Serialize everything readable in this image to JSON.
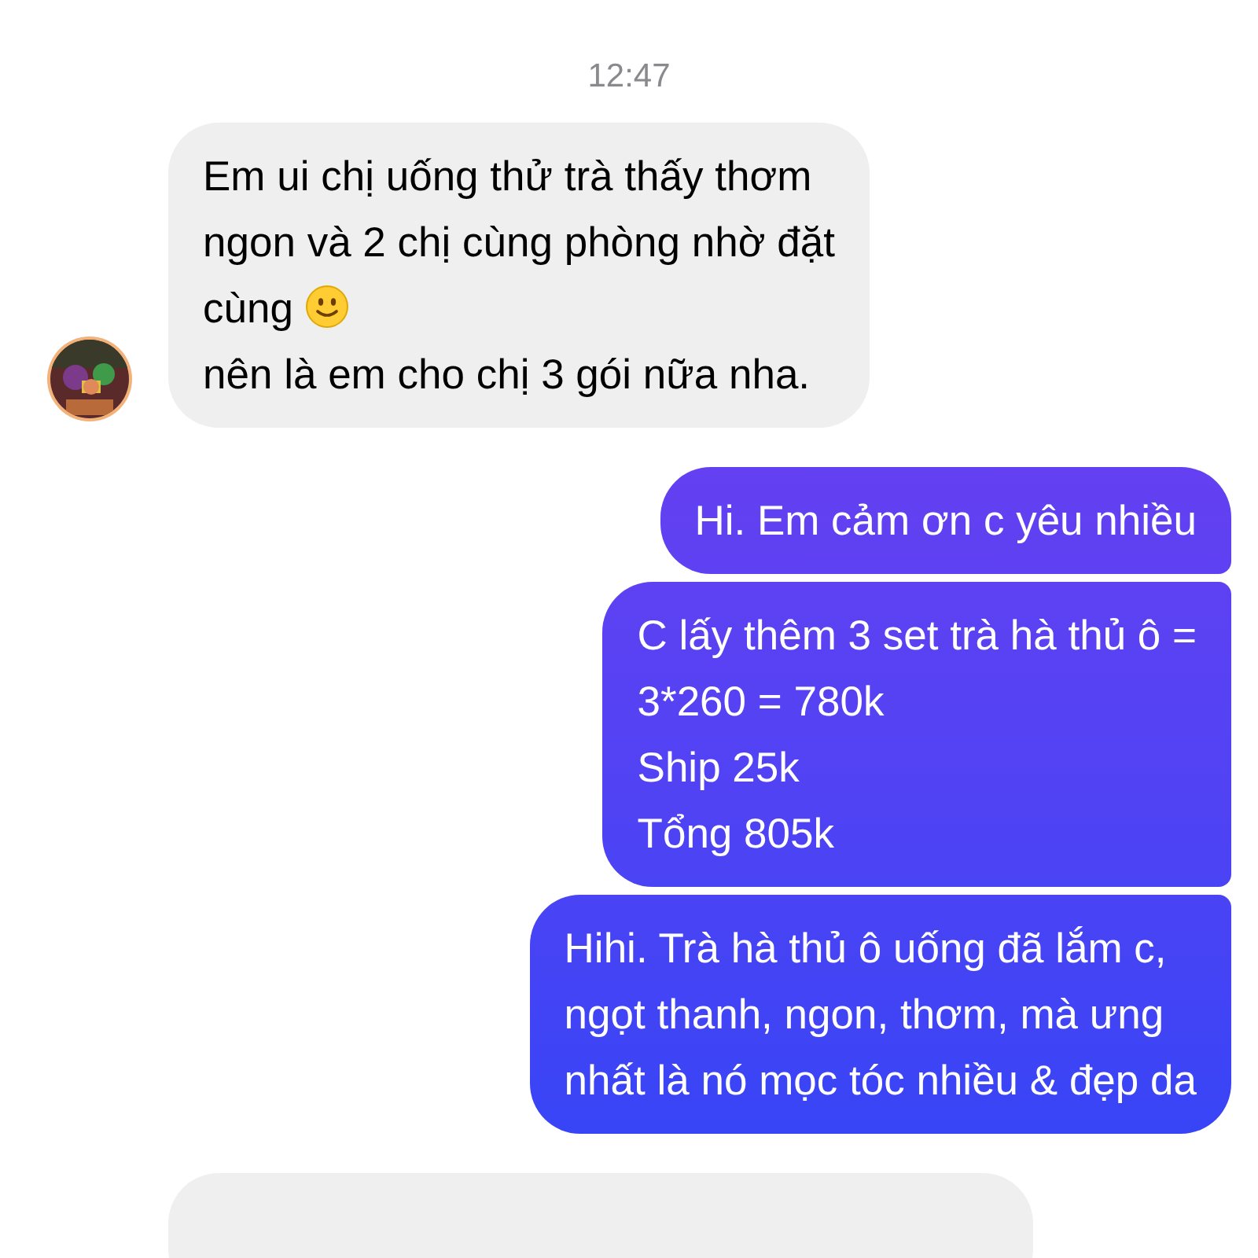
{
  "timestamp": "12:47",
  "messages": [
    {
      "kind": "received",
      "paragraphs": [
        {
          "text": "Em ui chị uống thử trà thấy thơm\nngon và 2 chị cùng phòng nhờ đặt",
          "emoji": false
        },
        {
          "text": "cùng",
          "emoji": true
        },
        {
          "text": "nên là em cho chị 3 gói nữa nha.",
          "emoji": false
        }
      ]
    },
    {
      "kind": "sent",
      "paragraphs": [
        {
          "text": "Hi. Em cảm ơn c yêu nhiều",
          "emoji": false
        }
      ]
    },
    {
      "kind": "sent",
      "paragraphs": [
        {
          "text": "C lấy thêm 3 set trà hà thủ ô =\n3*260 = 780k\nShip 25k\nTổng 805k",
          "emoji": false
        }
      ]
    },
    {
      "kind": "sent",
      "paragraphs": [
        {
          "text": "Hihi. Trà hà thủ ô uống đã lắm c,\nngọt thanh, ngon, thơm, mà ưng\nnhất là nó mọc tóc nhiều & đẹp da",
          "emoji": false
        }
      ]
    },
    {
      "kind": "received"
    }
  ]
}
